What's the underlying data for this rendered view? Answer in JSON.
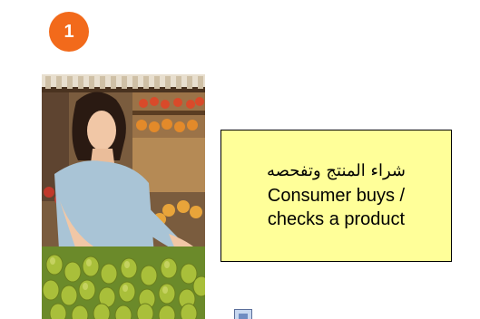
{
  "step": {
    "number": "1",
    "badge_color": "#f26a1b"
  },
  "photo": {
    "subject": "woman-choosing-pears"
  },
  "callout": {
    "arabic_text": "شراء المنتج وتفحصه",
    "english_line1": "Consumer buys /",
    "english_line2": "checks a product",
    "background_color": "#ffff99"
  },
  "icons": {
    "document": "document-icon"
  }
}
